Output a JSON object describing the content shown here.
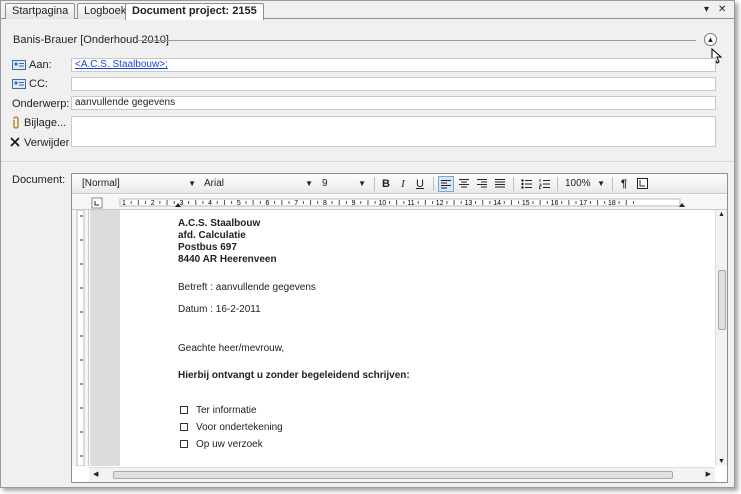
{
  "tabs": [
    {
      "label": "Startpagina"
    },
    {
      "label": "Logboek"
    },
    {
      "label": "Document project: 2155"
    }
  ],
  "window": {
    "pin": "▾",
    "close": "✕"
  },
  "header": {
    "title": "Banis-Brauer  [Onderhoud 2010]"
  },
  "fields": {
    "to_label": "Aan:",
    "to_value": "<A.C.S. Staalbouw>;",
    "cc_label": "CC:",
    "cc_value": "",
    "subject_label": "Onderwerp:",
    "subject_value": "aanvullende gegevens",
    "attach_label": "Bijlage...",
    "remove_label": "Verwijder",
    "document_label": "Document:"
  },
  "toolbar": {
    "style": "[Normal]",
    "font": "Arial",
    "size": "9",
    "bold": "B",
    "italic": "I",
    "underline": "U",
    "zoom": "100%",
    "pilcrow": "¶"
  },
  "ruler": {
    "numbers": [
      "1",
      "2",
      "3",
      "4",
      "5",
      "6",
      "7",
      "8",
      "9",
      "10",
      "11",
      "12",
      "13",
      "14",
      "15",
      "16",
      "17",
      "18"
    ]
  },
  "document": {
    "address": [
      "A.C.S. Staalbouw",
      "afd. Calculatie",
      "Postbus 697",
      "8440 AR  Heerenveen"
    ],
    "betreft": "Betreft  : aanvullende gegevens",
    "datum": "Datum   : 16-2-2011",
    "salutation": "Geachte heer/mevrouw,",
    "intro": "Hierbij ontvangt u zonder begeleidend schrijven:",
    "checklist": [
      "Ter informatie",
      "Voor ondertekening",
      "Op uw verzoek"
    ]
  }
}
